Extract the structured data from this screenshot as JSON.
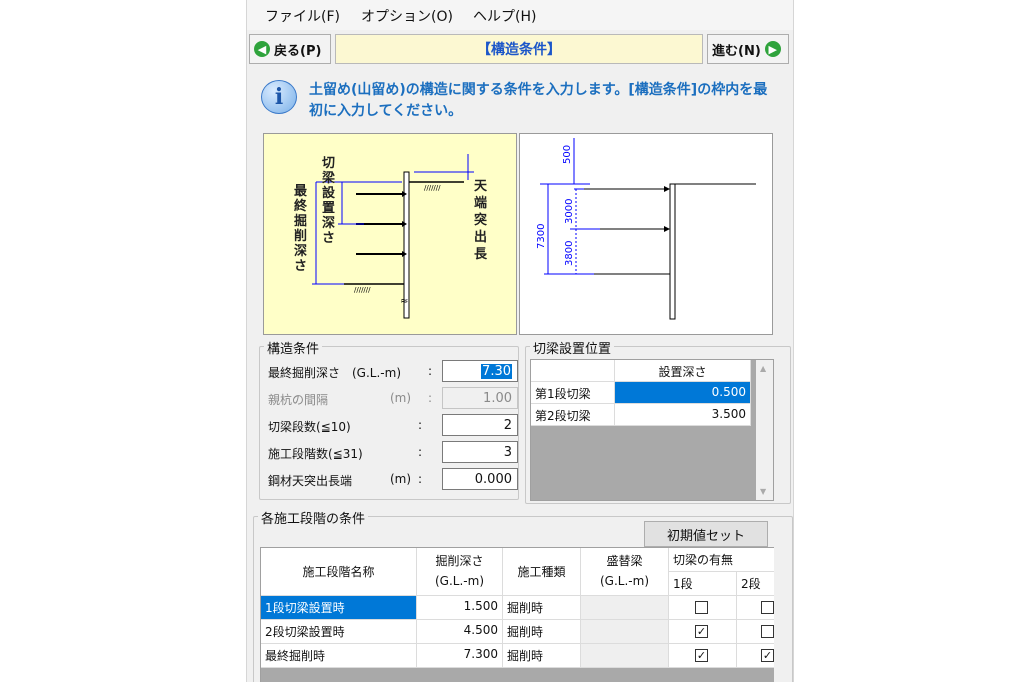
{
  "menu": {
    "file": "ファイル(F)",
    "options": "オプション(O)",
    "help": "ヘルプ(H)"
  },
  "nav": {
    "back": "戻る(P)",
    "title": "【構造条件】",
    "next": "進む(N)"
  },
  "info": {
    "text": "土留め(山留め)の構造に関する条件を入力します。[構造条件]の枠内を最初に入力してください。"
  },
  "diagram_left": {
    "strut_depth": "切梁設置深さ",
    "final_depth": "最終掘削深さ",
    "top_projection": "天端突出長"
  },
  "diagram_right": {
    "dim_top": "500",
    "dim_total": "7300",
    "dim_mid": "3000",
    "dim_low": "3800"
  },
  "structure": {
    "title": "構造条件",
    "rows": [
      {
        "label": "最終掘削深さ　(G.L.-m)",
        "sep": ":",
        "value": "7.30"
      },
      {
        "label": "親杭の間隔",
        "unit": "(m)",
        "sep": ":",
        "value": "1.00"
      },
      {
        "label": "切梁段数(≦10)",
        "sep": ":",
        "value": "2"
      },
      {
        "label": "施工段階数(≦31)",
        "sep": ":",
        "value": "3"
      },
      {
        "label": "鋼材天突出長端",
        "unit": "(m)",
        "sep": ":",
        "value": "0.000"
      }
    ]
  },
  "strut_position": {
    "title": "切梁設置位置",
    "header": "設置深さ",
    "rows": [
      {
        "name": "第1段切梁",
        "depth": "0.500"
      },
      {
        "name": "第2段切梁",
        "depth": "3.500"
      }
    ]
  },
  "stages": {
    "title": "各施工段階の条件",
    "reset_button": "初期値セット",
    "headers": {
      "name": "施工段階名称",
      "depth_1": "掘削深さ",
      "depth_2": "(G.L.-m)",
      "type": "施工種類",
      "beam_1": "盛替梁",
      "beam_2": "(G.L.-m)",
      "strut": "切梁の有無",
      "stage1": "1段",
      "stage2": "2段"
    },
    "rows": [
      {
        "name": "1段切梁設置時",
        "depth": "1.500",
        "type": "掘削時",
        "s1": "",
        "s2": ""
      },
      {
        "name": "2段切梁設置時",
        "depth": "4.500",
        "type": "掘削時",
        "s1": "✓",
        "s2": ""
      },
      {
        "name": "最終掘削時",
        "depth": "7.300",
        "type": "掘削時",
        "s1": "✓",
        "s2": "✓"
      }
    ]
  },
  "colors": {
    "accent": "#0078d7",
    "title_bg": "#fcf8d2",
    "info_text": "#1c6fbf",
    "diagram_bg": "#ffffc8"
  }
}
